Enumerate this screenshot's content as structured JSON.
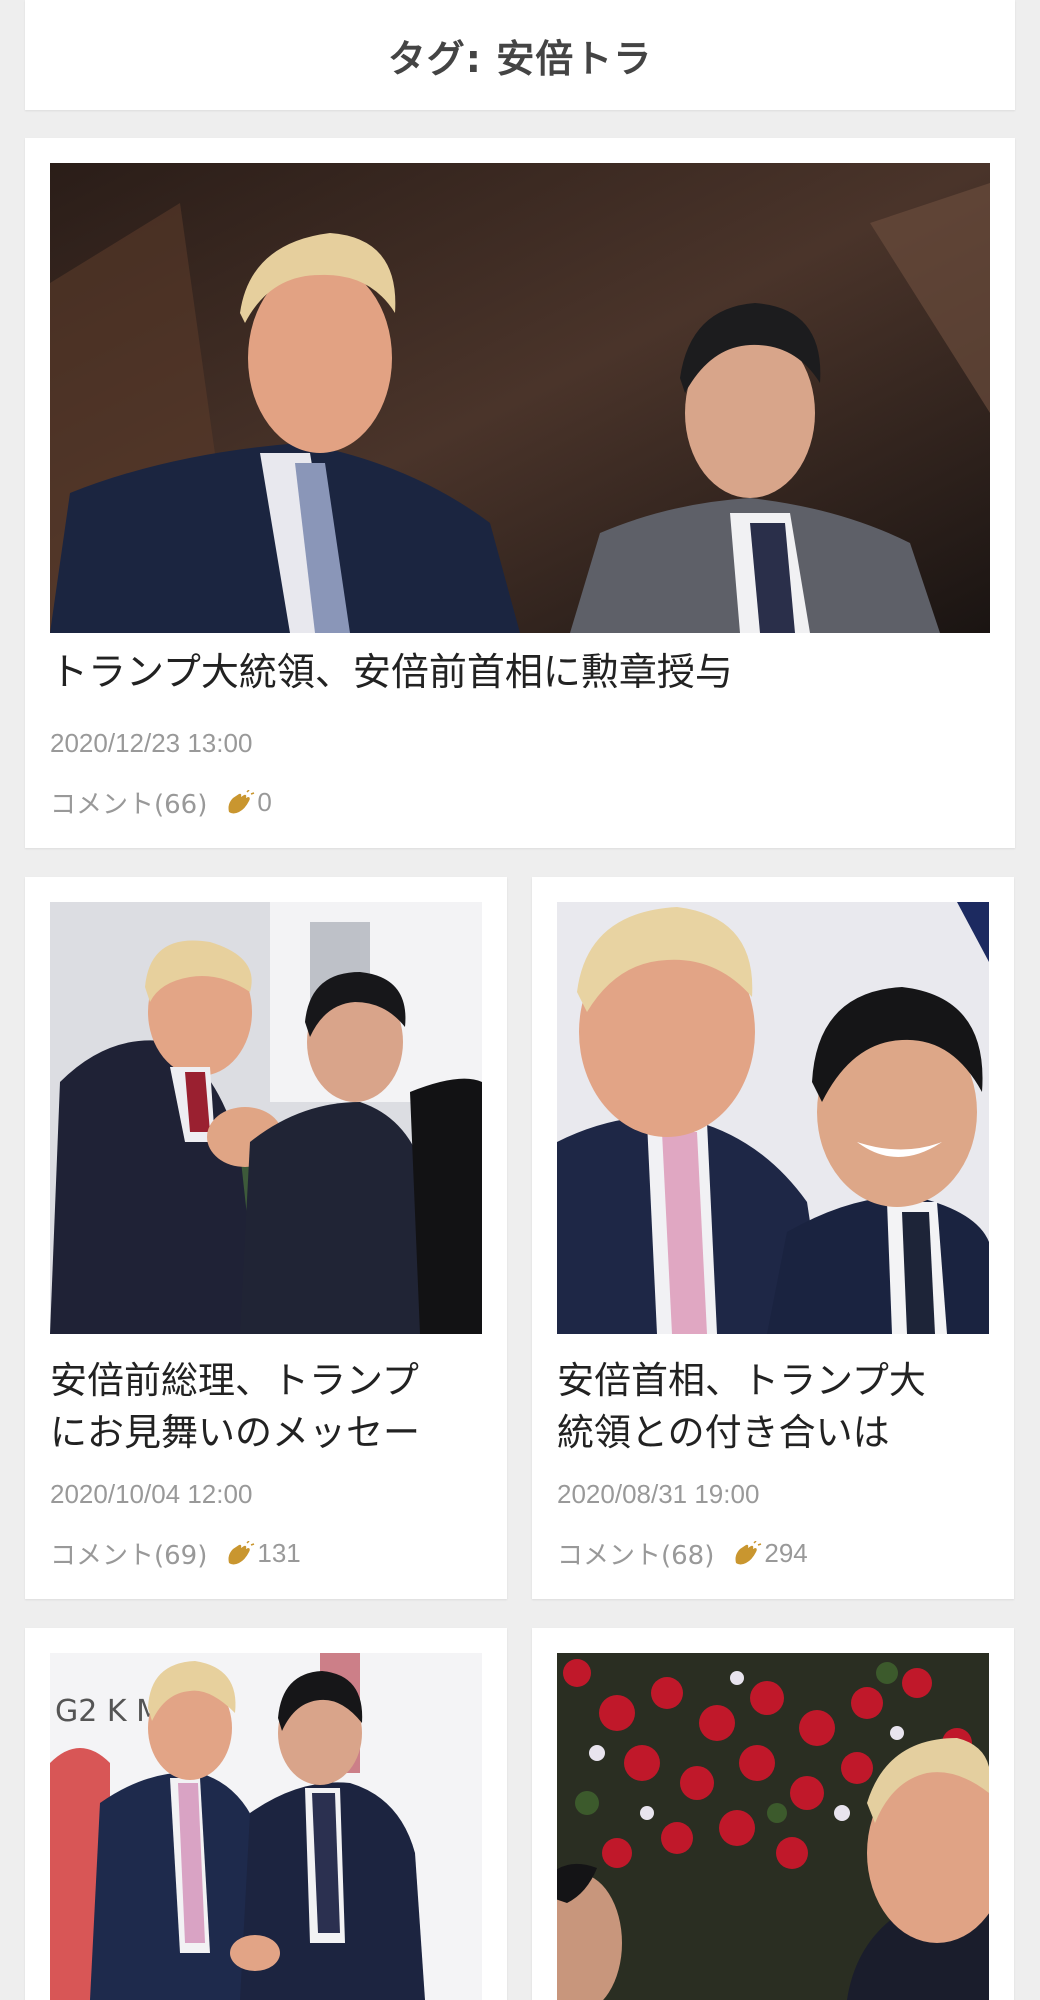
{
  "header": {
    "title": "タグ: 安倍トラ"
  },
  "articles": [
    {
      "title_lines": [
        "トランプ大統領、安倍前首相に勲章授与"
      ],
      "date": "2020/12/23 13:00",
      "comments": "コメント(66)",
      "claps": "0",
      "image": "photo-trump-and-abe-standing"
    },
    {
      "title_lines": [
        "安倍前総理、トランプ",
        "にお見舞いのメッセー"
      ],
      "date": "2020/10/04 12:00",
      "comments": "コメント(69)",
      "claps": "131",
      "image": "photo-trump-and-abe-handshake"
    },
    {
      "title_lines": [
        "安倍首相、トランプ大",
        "統領との付き合いは"
      ],
      "date": "2020/08/31 19:00",
      "comments": "コメント(68)",
      "claps": "294",
      "image": "photo-trump-and-abe-smiling"
    },
    {
      "title_lines": [],
      "image": "photo-trump-and-abe-g20-summit",
      "image_text": "G2  K  MMIT"
    },
    {
      "image": "photo-abe-and-trump-flowers"
    }
  ],
  "colors": {
    "background": "#eeeeee",
    "card": "#ffffff",
    "title_text": "#222222",
    "meta_text": "#999999",
    "clap_icon": "#c9962f"
  }
}
